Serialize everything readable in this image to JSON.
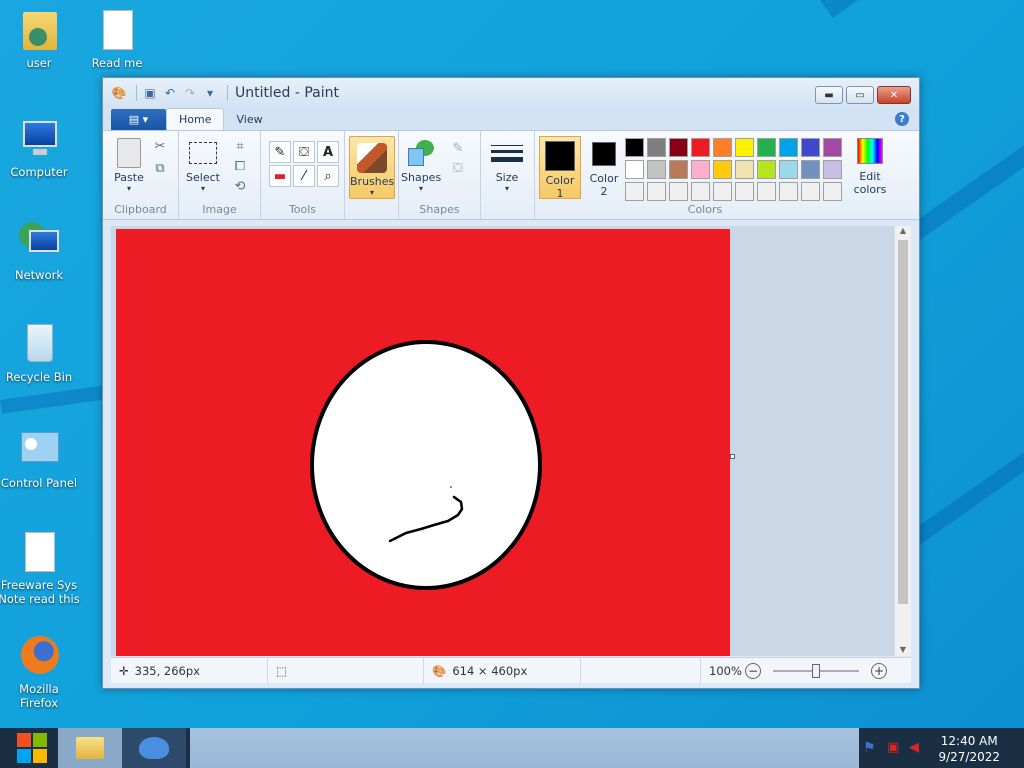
{
  "desktop": {
    "icons": [
      {
        "label": "user"
      },
      {
        "label": "Read me"
      },
      {
        "label": "Computer"
      },
      {
        "label": "Network"
      },
      {
        "label": "Recycle Bin"
      },
      {
        "label": "Control Panel"
      },
      {
        "label": "Freeware Sys Note read this"
      },
      {
        "label": "Mozilla Firefox"
      }
    ]
  },
  "window": {
    "title": "Untitled - Paint",
    "tabs": {
      "file": "▤ ▾",
      "home": "Home",
      "view": "View"
    },
    "help": "?"
  },
  "ribbon": {
    "clipboard": {
      "label": "Clipboard",
      "paste": "Paste"
    },
    "image": {
      "label": "Image",
      "select": "Select"
    },
    "tools": {
      "label": "Tools"
    },
    "brushes": "Brushes",
    "shapes": {
      "label": "Shapes",
      "button": "Shapes"
    },
    "size": "Size",
    "colors": {
      "label": "Colors",
      "color1_line1": "Color",
      "color1_line2": "1",
      "color2_line1": "Color",
      "color2_line2": "2",
      "edit_line1": "Edit",
      "edit_line2": "colors",
      "color1_value": "#000000",
      "color2_value": "#000000",
      "palette": [
        "#000000",
        "#7f7f7f",
        "#880015",
        "#ed1c24",
        "#ff7f27",
        "#fff200",
        "#22b14c",
        "#00a2e8",
        "#3f48cc",
        "#a349a4",
        "#ffffff",
        "#c3c3c3",
        "#b97a57",
        "#ffaec9",
        "#ffc90e",
        "#efe4b0",
        "#b5e61d",
        "#99d9ea",
        "#7092be",
        "#c8bfe7",
        "#f0f0f0",
        "#f0f0f0",
        "#f0f0f0",
        "#f0f0f0",
        "#f0f0f0",
        "#f0f0f0",
        "#f0f0f0",
        "#f0f0f0",
        "#f0f0f0",
        "#f0f0f0"
      ]
    }
  },
  "canvas": {
    "background": "#ed1c24"
  },
  "status": {
    "cursor": "335, 266px",
    "size": "614 × 460px",
    "zoom": "100%",
    "zoom_level": 0.5
  },
  "taskbar": {
    "time": "12:40 AM",
    "date": "9/27/2022"
  }
}
